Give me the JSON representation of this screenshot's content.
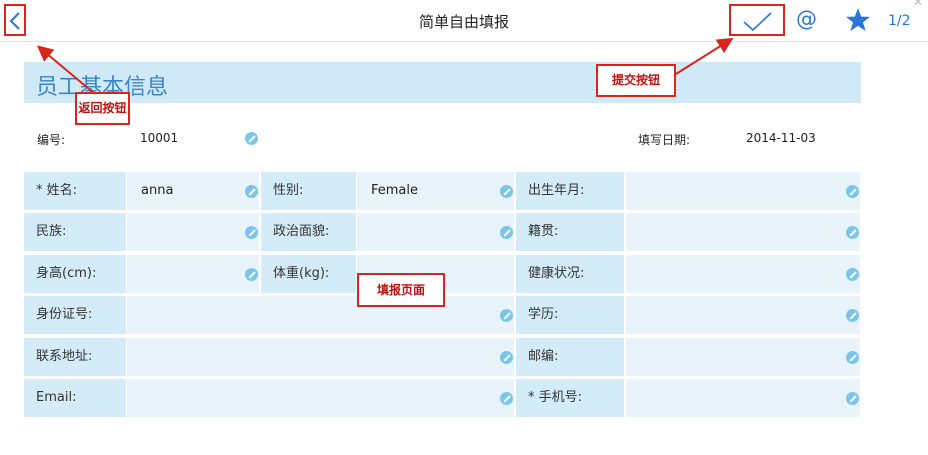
{
  "header": {
    "title": "简单自由填报",
    "page_indicator": "1/2",
    "at_symbol": "@"
  },
  "section": {
    "title": "员工基本信息"
  },
  "info": {
    "id_label": "编号:",
    "id_value": "10001",
    "date_label": "填写日期:",
    "date_value": "2014-11-03"
  },
  "form": {
    "row1": {
      "l1": "* 姓名:",
      "v1": "anna",
      "l2": "性别:",
      "v2": "Female",
      "l3": "出生年月:",
      "v3": ""
    },
    "row2": {
      "l1": "民族:",
      "v1": "",
      "l2": "政治面貌:",
      "v2": "",
      "l3": "籍贯:",
      "v3": ""
    },
    "row3": {
      "l1": "身高(cm):",
      "v1": "",
      "l2": "体重(kg):",
      "v2": "",
      "l3": "健康状况:",
      "v3": ""
    },
    "row4": {
      "l1": "身份证号:",
      "v1": "",
      "l3": "学历:",
      "v3": ""
    },
    "row5": {
      "l1": "联系地址:",
      "v1": "",
      "l3": "邮编:",
      "v3": ""
    },
    "row6": {
      "l1": "Email:",
      "v1": "",
      "l3": "* 手机号:",
      "v3": ""
    }
  },
  "annotations": {
    "back": "返回按钮",
    "submit": "提交按钮",
    "form_page": "填报页面"
  },
  "colors": {
    "accent": "#2a76d6",
    "annotation": "#d9251c",
    "label_bg": "#d3ecf8",
    "value_bg": "#e8f4f9",
    "header_bg": "#cfe9f7",
    "edit_icon": "#7cc5ea"
  },
  "icons": [
    "back-chevron-icon",
    "checkmark-icon",
    "at-icon",
    "star-icon",
    "pencil-icon"
  ]
}
